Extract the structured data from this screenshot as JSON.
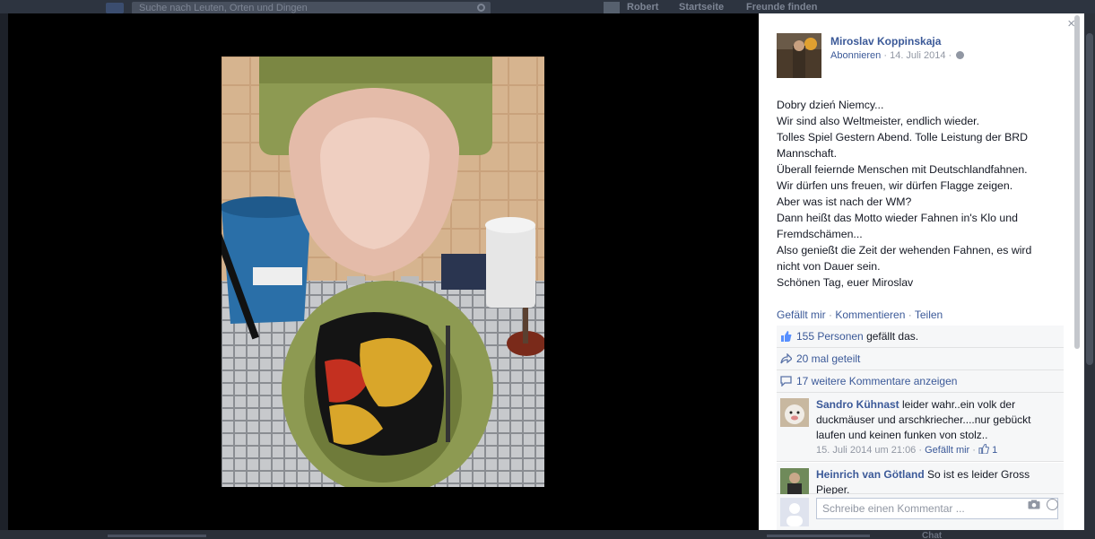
{
  "topbar": {
    "search_placeholder": "Suche nach Leuten, Orten und Dingen",
    "nav_user": "Robert",
    "nav_home": "Startseite",
    "nav_find_friends": "Freunde finden"
  },
  "bottom": {
    "chat_label": "Chat"
  },
  "sidebar": {
    "close_label": "×",
    "author": {
      "name": "Miroslav Koppinskaja",
      "subscribe": "Abonnieren",
      "date": "14. Juli 2014"
    },
    "post_lines": [
      "Dobry dzień Niemcy...",
      "Wir sind also Weltmeister, endlich wieder.",
      "Tolles Spiel Gestern Abend. Tolle Leistung der BRD",
      "Mannschaft.",
      "Überall feiernde Menschen mit Deutschlandfahnen.",
      "Wir dürfen uns freuen, wir dürfen Flagge zeigen.",
      "Aber was ist nach der WM?",
      "Dann heißt das Motto wieder Fahnen in's Klo und",
      "Fremdschämen...",
      "Also genießt die Zeit der wehenden Fahnen, es wird",
      "nicht von Dauer sein.",
      "Schönen Tag, euer Miroslav"
    ],
    "actions": {
      "like": "Gefällt mir",
      "comment": "Kommentieren",
      "share": "Teilen",
      "sep": " · "
    },
    "likes": {
      "count_link": "155 Personen",
      "suffix": " gefällt das."
    },
    "shares": "20 mal geteilt",
    "more_comments": "17 weitere Kommentare anzeigen",
    "comments": [
      {
        "name": "Sandro Kühnast",
        "text": " leider wahr..ein volk der duckmäuser und arschkriecher....nur gebückt laufen und keinen funken von stolz..",
        "time": "15. Juli 2014 um 21:06",
        "like": "Gefällt mir",
        "like_count": "1"
      },
      {
        "name": "Heinrich van Götland",
        "text": " So ist es leider Gross Pieper."
      }
    ],
    "compose_placeholder": "Schreibe einen Kommentar ..."
  },
  "colors": {
    "link": "#3b5998",
    "meta": "#9197a3",
    "panel": "#f6f7f8",
    "stage": "#000000"
  }
}
